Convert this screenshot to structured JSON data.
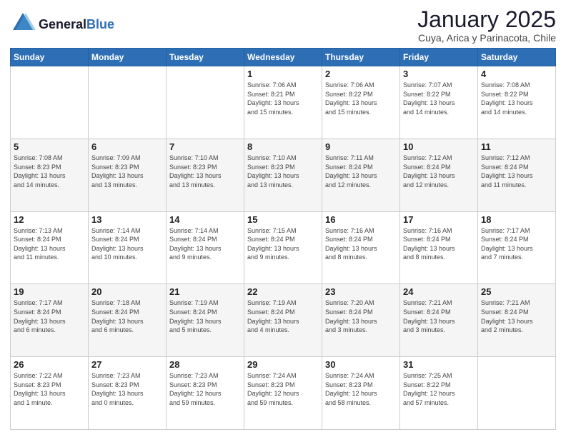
{
  "logo": {
    "general": "General",
    "blue": "Blue"
  },
  "title": "January 2025",
  "location": "Cuya, Arica y Parinacota, Chile",
  "days_header": [
    "Sunday",
    "Monday",
    "Tuesday",
    "Wednesday",
    "Thursday",
    "Friday",
    "Saturday"
  ],
  "weeks": [
    [
      {
        "day": "",
        "info": ""
      },
      {
        "day": "",
        "info": ""
      },
      {
        "day": "",
        "info": ""
      },
      {
        "day": "1",
        "info": "Sunrise: 7:06 AM\nSunset: 8:21 PM\nDaylight: 13 hours\nand 15 minutes."
      },
      {
        "day": "2",
        "info": "Sunrise: 7:06 AM\nSunset: 8:22 PM\nDaylight: 13 hours\nand 15 minutes."
      },
      {
        "day": "3",
        "info": "Sunrise: 7:07 AM\nSunset: 8:22 PM\nDaylight: 13 hours\nand 14 minutes."
      },
      {
        "day": "4",
        "info": "Sunrise: 7:08 AM\nSunset: 8:22 PM\nDaylight: 13 hours\nand 14 minutes."
      }
    ],
    [
      {
        "day": "5",
        "info": "Sunrise: 7:08 AM\nSunset: 8:23 PM\nDaylight: 13 hours\nand 14 minutes."
      },
      {
        "day": "6",
        "info": "Sunrise: 7:09 AM\nSunset: 8:23 PM\nDaylight: 13 hours\nand 13 minutes."
      },
      {
        "day": "7",
        "info": "Sunrise: 7:10 AM\nSunset: 8:23 PM\nDaylight: 13 hours\nand 13 minutes."
      },
      {
        "day": "8",
        "info": "Sunrise: 7:10 AM\nSunset: 8:23 PM\nDaylight: 13 hours\nand 13 minutes."
      },
      {
        "day": "9",
        "info": "Sunrise: 7:11 AM\nSunset: 8:24 PM\nDaylight: 13 hours\nand 12 minutes."
      },
      {
        "day": "10",
        "info": "Sunrise: 7:12 AM\nSunset: 8:24 PM\nDaylight: 13 hours\nand 12 minutes."
      },
      {
        "day": "11",
        "info": "Sunrise: 7:12 AM\nSunset: 8:24 PM\nDaylight: 13 hours\nand 11 minutes."
      }
    ],
    [
      {
        "day": "12",
        "info": "Sunrise: 7:13 AM\nSunset: 8:24 PM\nDaylight: 13 hours\nand 11 minutes."
      },
      {
        "day": "13",
        "info": "Sunrise: 7:14 AM\nSunset: 8:24 PM\nDaylight: 13 hours\nand 10 minutes."
      },
      {
        "day": "14",
        "info": "Sunrise: 7:14 AM\nSunset: 8:24 PM\nDaylight: 13 hours\nand 9 minutes."
      },
      {
        "day": "15",
        "info": "Sunrise: 7:15 AM\nSunset: 8:24 PM\nDaylight: 13 hours\nand 9 minutes."
      },
      {
        "day": "16",
        "info": "Sunrise: 7:16 AM\nSunset: 8:24 PM\nDaylight: 13 hours\nand 8 minutes."
      },
      {
        "day": "17",
        "info": "Sunrise: 7:16 AM\nSunset: 8:24 PM\nDaylight: 13 hours\nand 8 minutes."
      },
      {
        "day": "18",
        "info": "Sunrise: 7:17 AM\nSunset: 8:24 PM\nDaylight: 13 hours\nand 7 minutes."
      }
    ],
    [
      {
        "day": "19",
        "info": "Sunrise: 7:17 AM\nSunset: 8:24 PM\nDaylight: 13 hours\nand 6 minutes."
      },
      {
        "day": "20",
        "info": "Sunrise: 7:18 AM\nSunset: 8:24 PM\nDaylight: 13 hours\nand 6 minutes."
      },
      {
        "day": "21",
        "info": "Sunrise: 7:19 AM\nSunset: 8:24 PM\nDaylight: 13 hours\nand 5 minutes."
      },
      {
        "day": "22",
        "info": "Sunrise: 7:19 AM\nSunset: 8:24 PM\nDaylight: 13 hours\nand 4 minutes."
      },
      {
        "day": "23",
        "info": "Sunrise: 7:20 AM\nSunset: 8:24 PM\nDaylight: 13 hours\nand 3 minutes."
      },
      {
        "day": "24",
        "info": "Sunrise: 7:21 AM\nSunset: 8:24 PM\nDaylight: 13 hours\nand 3 minutes."
      },
      {
        "day": "25",
        "info": "Sunrise: 7:21 AM\nSunset: 8:24 PM\nDaylight: 13 hours\nand 2 minutes."
      }
    ],
    [
      {
        "day": "26",
        "info": "Sunrise: 7:22 AM\nSunset: 8:23 PM\nDaylight: 13 hours\nand 1 minute."
      },
      {
        "day": "27",
        "info": "Sunrise: 7:23 AM\nSunset: 8:23 PM\nDaylight: 13 hours\nand 0 minutes."
      },
      {
        "day": "28",
        "info": "Sunrise: 7:23 AM\nSunset: 8:23 PM\nDaylight: 12 hours\nand 59 minutes."
      },
      {
        "day": "29",
        "info": "Sunrise: 7:24 AM\nSunset: 8:23 PM\nDaylight: 12 hours\nand 59 minutes."
      },
      {
        "day": "30",
        "info": "Sunrise: 7:24 AM\nSunset: 8:23 PM\nDaylight: 12 hours\nand 58 minutes."
      },
      {
        "day": "31",
        "info": "Sunrise: 7:25 AM\nSunset: 8:22 PM\nDaylight: 12 hours\nand 57 minutes."
      },
      {
        "day": "",
        "info": ""
      }
    ]
  ]
}
